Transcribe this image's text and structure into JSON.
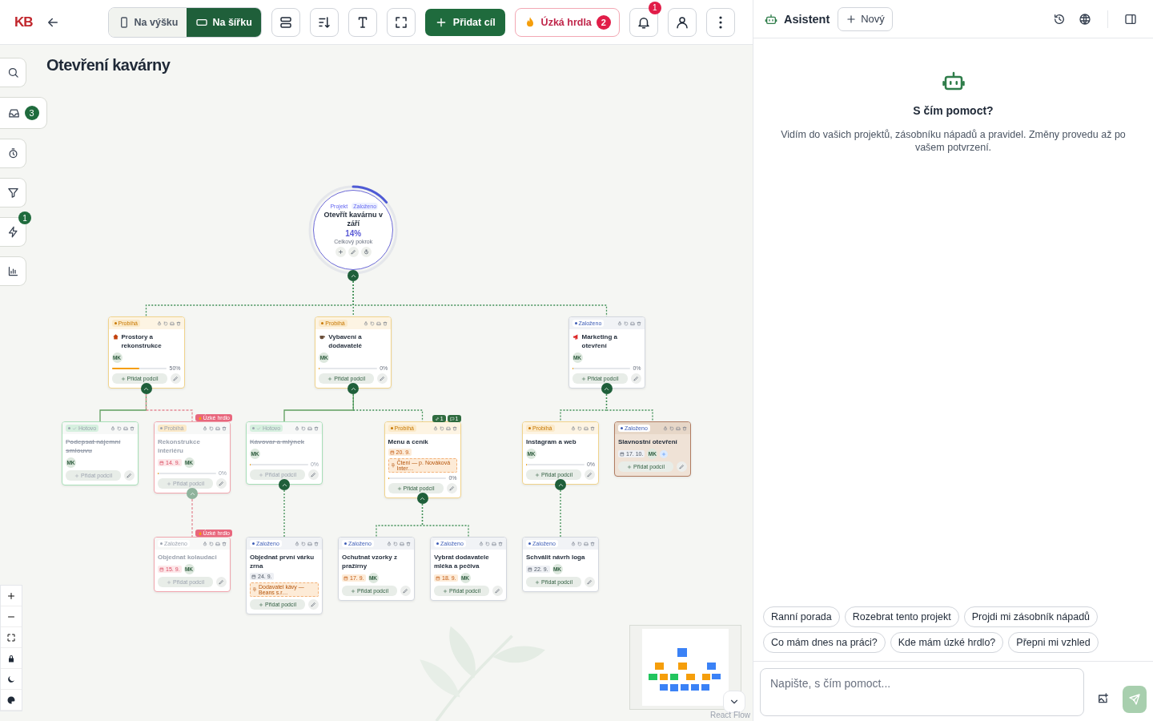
{
  "toolbar": {
    "logo": "KB",
    "orientation": [
      {
        "label": "Na výšku",
        "selected": false
      },
      {
        "label": "Na šířku",
        "selected": true
      }
    ],
    "add_goal": "Přidat cíl",
    "bottlenecks": "Úzká hrdla",
    "bottleneck_count": "2",
    "notification_count": "1"
  },
  "rail": [
    {
      "kind": "search"
    },
    {
      "kind": "inbox",
      "badge": "3"
    },
    {
      "kind": "timer"
    },
    {
      "kind": "filter"
    },
    {
      "kind": "bolt",
      "badge": "1"
    },
    {
      "kind": "chart"
    }
  ],
  "canvas": {
    "title": "Otevření kavárny",
    "root": {
      "type_label": "Projekt",
      "status_label": "Založeno",
      "title": "Otevřít kavárnu v září",
      "percent": "14%",
      "level": 0.14,
      "caption": "Celkový pokrok",
      "expanded": true,
      "children": [
        {
          "kind": "progress",
          "status_label": "Probíhá",
          "title": "Prostory a rekonstrukce",
          "avatar": "MK",
          "level": 0.5,
          "percent": "50%",
          "add_label": "Přidat podcíl",
          "expanded": true,
          "dimmed": false,
          "selected": false,
          "children": [
            {
              "kind": "done",
              "status_label": "Hotovo",
              "title": "Podepsat nájemní smlouvu",
              "avatar": "MK",
              "add_label": "Přidat podcíl",
              "dimmed": true,
              "selected": false
            },
            {
              "kind": "progress",
              "status_label": "Probíhá",
              "flag": "Úzké hrdlo",
              "title": "Rekonstrukce interiéru",
              "due": {
                "text": "14. 9.",
                "kind": "overdue"
              },
              "avatar": "MK",
              "level": 0,
              "percent": "0%",
              "add_label": "Přidat podcíl",
              "expanded": true,
              "dimmed": true,
              "selected": false,
              "children": [
                {
                  "kind": "created",
                  "status_label": "Založeno",
                  "flag": "Úzké hrdlo",
                  "title": "Objednat kolaudaci",
                  "due": {
                    "text": "15. 9.",
                    "kind": "overdue"
                  },
                  "avatar": "MK",
                  "add_label": "Přidat podcíl",
                  "dimmed": true,
                  "selected": false
                }
              ]
            }
          ]
        },
        {
          "kind": "progress",
          "status_label": "Probíhá",
          "title": "Vybavení a dodavatelé",
          "avatar": "MK",
          "level": 0,
          "percent": "0%",
          "add_label": "Přidat podcíl",
          "expanded": true,
          "dimmed": false,
          "selected": false,
          "children": [
            {
              "kind": "done",
              "status_label": "Hotovo",
              "title": "Kávovar a mlýnek",
              "avatar": "MK",
              "level": 0,
              "percent": "0%",
              "add_label": "Přidat podcíl",
              "expanded": true,
              "dimmed": true,
              "selected": false,
              "children": [
                {
                  "kind": "created",
                  "status_label": "Založeno",
                  "title": "Objednat první várku zrna",
                  "due": {
                    "text": "24. 9.",
                    "kind": "normal"
                  },
                  "note": "Dodavatel kávy — Beans s.r…",
                  "add_label": "Přidat podcíl",
                  "dimmed": false,
                  "selected": false
                }
              ]
            },
            {
              "kind": "progress",
              "status_label": "Probíhá",
              "counters": [
                {
                  "kind": "link",
                  "count": "1"
                },
                {
                  "kind": "comment",
                  "count": "1"
                }
              ],
              "title": "Menu a ceník",
              "due": {
                "text": "20. 9.",
                "kind": "soon"
              },
              "note": "Čtení — p. Nováková Inter…",
              "level": 0,
              "percent": "0%",
              "add_label": "Přidat podcíl",
              "expanded": true,
              "dimmed": false,
              "selected": false,
              "children": [
                {
                  "kind": "created",
                  "status_label": "Založeno",
                  "title": "Ochutnat vzorky z pražírny",
                  "due": {
                    "text": "17. 9.",
                    "kind": "soon"
                  },
                  "avatar": "MK",
                  "add_label": "Přidat podcíl",
                  "dimmed": false,
                  "selected": false
                },
                {
                  "kind": "created",
                  "status_label": "Založeno",
                  "title": "Vybrat dodavatele mléka a pečiva",
                  "due": {
                    "text": "18. 9.",
                    "kind": "soon"
                  },
                  "avatar": "MK",
                  "add_label": "Přidat podcíl",
                  "dimmed": false,
                  "selected": false
                }
              ]
            }
          ]
        },
        {
          "kind": "created",
          "status_label": "Založeno",
          "title": "Marketing a otevření",
          "avatar": "MK",
          "level": 0,
          "percent": "0%",
          "add_label": "Přidat podcíl",
          "expanded": true,
          "dimmed": false,
          "selected": false,
          "children": [
            {
              "kind": "progress",
              "status_label": "Probíhá",
              "title": "Instagram a web",
              "avatar": "MK",
              "level": 0,
              "percent": "0%",
              "add_label": "Přidat podcíl",
              "expanded": true,
              "dimmed": false,
              "selected": false,
              "children": [
                {
                  "kind": "created",
                  "status_label": "Založeno",
                  "title": "Schválit návrh loga",
                  "due": {
                    "text": "22. 9.",
                    "kind": "normal"
                  },
                  "avatar": "MK",
                  "add_label": "Přidat podcíl",
                  "dimmed": false,
                  "selected": false
                }
              ]
            },
            {
              "kind": "created",
              "status_label": "Založeno",
              "title": "Slavnostní otevření",
              "due": {
                "text": "17. 10.",
                "kind": "normal"
              },
              "avatar": "MK",
              "add_label": "Přidat podcíl",
              "dimmed": false,
              "selected": true
            }
          ]
        }
      ]
    },
    "controls": [
      {
        "kind": "plus"
      },
      {
        "kind": "minus"
      },
      {
        "kind": "fit"
      },
      {
        "kind": "lock"
      },
      {
        "kind": "moon"
      },
      {
        "kind": "palette"
      }
    ],
    "attribution": "React Flow"
  },
  "assistant": {
    "title": "Asistent",
    "new_label": "Nový",
    "heading": "S čím pomoct?",
    "intro": "Vidím do vašich projektů, zásobníku nápadů a pravidel. Změny provedu až po vašem potvrzení.",
    "suggestions": [
      "Ranní porada",
      "Rozebrat tento projekt",
      "Projdi mi zásobník nápadů",
      "Co mám dnes na práci?",
      "Kde mám úzké hrdlo?",
      "Přepni mi vzhled"
    ],
    "placeholder": "Napište, s čím pomoct..."
  }
}
